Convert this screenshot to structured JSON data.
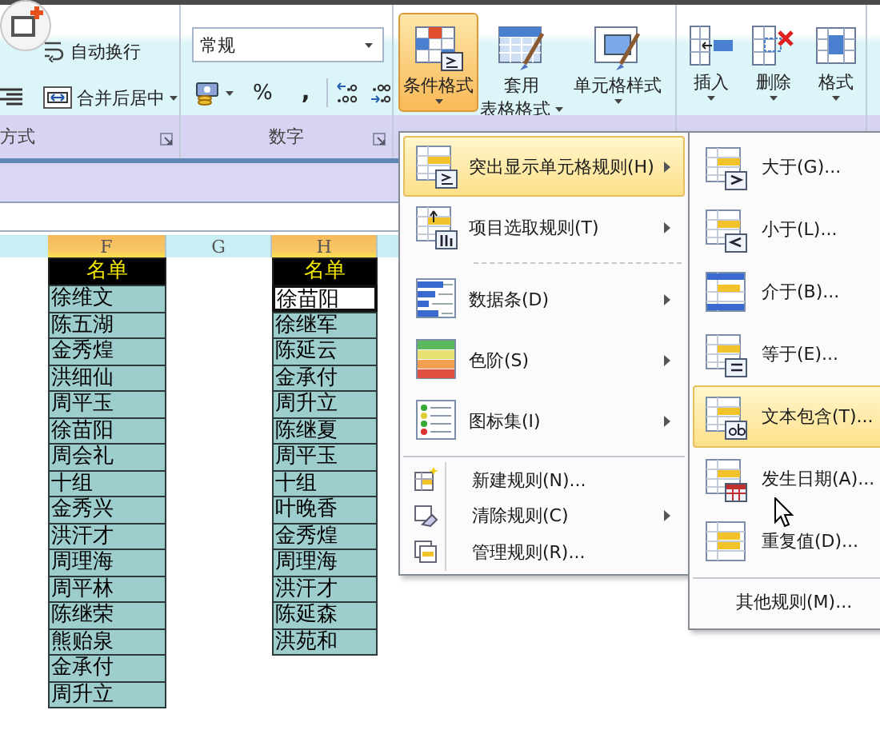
{
  "ribbon": {
    "alignment": {
      "label": "方式",
      "wrap_text": "自动换行",
      "merge_center": "合并后居中"
    },
    "number": {
      "label": "数字",
      "format": "常规",
      "percent": "%",
      "comma": ","
    },
    "styles": [
      {
        "lines": [
          "条件格式"
        ],
        "selected": true
      },
      {
        "lines": [
          "套用",
          "表格格式"
        ],
        "selected": false
      },
      {
        "lines": [
          "单元格样式"
        ],
        "selected": false
      }
    ],
    "cells": [
      {
        "label": "插入"
      },
      {
        "label": "删除"
      },
      {
        "label": "格式"
      }
    ]
  },
  "sheet": {
    "columns": [
      {
        "letter": "F",
        "highlighted": true,
        "header": "名单",
        "cells": [
          {
            "text": "徐维文",
            "selected": false
          },
          {
            "text": "陈五湖",
            "selected": false
          },
          {
            "text": "金秀煌",
            "selected": false
          },
          {
            "text": "洪细仙",
            "selected": false
          },
          {
            "text": "周平玉",
            "selected": false
          },
          {
            "text": "徐苗阳",
            "selected": false
          },
          {
            "text": "周会礼",
            "selected": false
          },
          {
            "text": "十组",
            "selected": false
          },
          {
            "text": "金秀兴",
            "selected": false
          },
          {
            "text": "洪汗才",
            "selected": false
          },
          {
            "text": "周理海",
            "selected": false
          },
          {
            "text": "周平林",
            "selected": false
          },
          {
            "text": "陈继荣",
            "selected": false
          },
          {
            "text": "熊贻泉",
            "selected": false
          },
          {
            "text": "金承付",
            "selected": false
          },
          {
            "text": "周升立",
            "selected": false
          }
        ]
      },
      {
        "letter": "G",
        "highlighted": false
      },
      {
        "letter": "H",
        "highlighted": true,
        "header": "名单",
        "cells": [
          {
            "text": "徐苗阳",
            "selected": true
          },
          {
            "text": "徐继军",
            "selected": false
          },
          {
            "text": "陈延云",
            "selected": false
          },
          {
            "text": "金承付",
            "selected": false
          },
          {
            "text": "周升立",
            "selected": false
          },
          {
            "text": "陈继夏",
            "selected": false
          },
          {
            "text": "周平玉",
            "selected": false
          },
          {
            "text": "十组",
            "selected": false
          },
          {
            "text": "叶晚香",
            "selected": false
          },
          {
            "text": "金秀煌",
            "selected": false
          },
          {
            "text": "周理海",
            "selected": false
          },
          {
            "text": "洪汗才",
            "selected": false
          },
          {
            "text": "陈延森",
            "selected": false
          },
          {
            "text": "洪苑和",
            "selected": false
          }
        ]
      }
    ]
  },
  "menu": {
    "sections": [
      {
        "items": [
          {
            "kind": "large",
            "label": "突出显示单元格规则(H)",
            "submenu": true,
            "selected": true
          },
          {
            "kind": "large",
            "label": "项目选取规则(T)",
            "submenu": true,
            "selected": false
          }
        ]
      },
      {
        "items": [
          {
            "kind": "large",
            "label": "数据条(D)",
            "submenu": true,
            "selected": false
          },
          {
            "kind": "large",
            "label": "色阶(S)",
            "submenu": true,
            "selected": false
          },
          {
            "kind": "large",
            "label": "图标集(I)",
            "submenu": true,
            "selected": false
          }
        ]
      },
      {
        "items": [
          {
            "kind": "small",
            "label": "新建规则(N)...",
            "submenu": false,
            "selected": false
          },
          {
            "kind": "small",
            "label": "清除规则(C)",
            "submenu": true,
            "selected": false
          },
          {
            "kind": "small",
            "label": "管理规则(R)...",
            "submenu": false,
            "selected": false
          }
        ]
      }
    ]
  },
  "submenu": {
    "items": [
      {
        "label": "大于(G)...",
        "selected": false
      },
      {
        "label": "小于(L)...",
        "selected": false
      },
      {
        "label": "介于(B)...",
        "selected": false
      },
      {
        "label": "等于(E)...",
        "selected": false
      },
      {
        "label": "文本包含(T)...",
        "selected": true
      },
      {
        "label": "发生日期(A)...",
        "selected": false
      },
      {
        "label": "重复值(D)...",
        "selected": false
      }
    ],
    "footer": "其他规则(M)..."
  }
}
